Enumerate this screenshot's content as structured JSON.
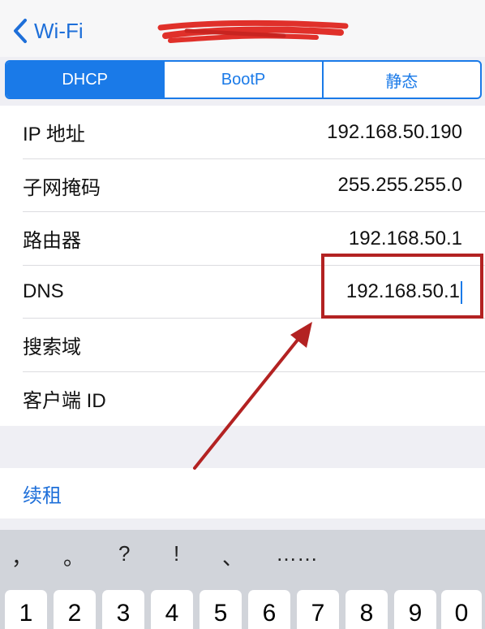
{
  "nav": {
    "back_label": "Wi-Fi",
    "title": ""
  },
  "segment": {
    "items": [
      "DHCP",
      "BootP",
      "静态"
    ],
    "active_index": 0
  },
  "fields": [
    {
      "label": "IP 地址",
      "value": "192.168.50.190"
    },
    {
      "label": "子网掩码",
      "value": "255.255.255.0"
    },
    {
      "label": "路由器",
      "value": "192.168.50.1"
    },
    {
      "label": "DNS",
      "value": "192.168.50.1"
    },
    {
      "label": "搜索域",
      "value": ""
    },
    {
      "label": "客户端 ID",
      "value": ""
    }
  ],
  "renew": {
    "label": "续租"
  },
  "keyboard": {
    "punctuation": [
      "，",
      "。",
      "?",
      "!",
      "、",
      "……"
    ],
    "numbers": [
      "1",
      "2",
      "3",
      "4",
      "5",
      "6",
      "7",
      "8",
      "9",
      "0"
    ]
  },
  "colors": {
    "accent": "#1a7ae8",
    "annotation": "#b32222"
  },
  "icons": {
    "back": "chevron-left-icon"
  }
}
